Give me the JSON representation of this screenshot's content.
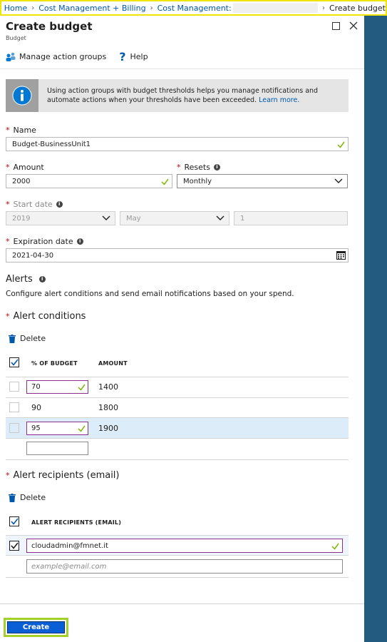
{
  "breadcrumb": {
    "home": "Home",
    "billing": "Cost Management + Billing",
    "cost_mgmt": "Cost Management:",
    "current": "Create budget"
  },
  "blade": {
    "title": "Create budget",
    "subtitle": "Budget"
  },
  "toolbar": {
    "manage_action_groups": "Manage action groups",
    "help": "Help"
  },
  "info": {
    "text": "Using action groups with budget thresholds helps you manage notifications and automate actions when your thresholds have been exceeded.",
    "link": "Learn more."
  },
  "form": {
    "name_label": "Name",
    "name_value": "Budget-BusinessUnit1",
    "amount_label": "Amount",
    "amount_value": "2000",
    "resets_label": "Resets",
    "resets_value": "Monthly",
    "start_date_label": "Start date",
    "start_year": "2019",
    "start_month": "May",
    "start_day": "1",
    "expiration_label": "Expiration date",
    "expiration_value": "2021-04-30"
  },
  "alerts": {
    "heading": "Alerts",
    "description": "Configure alert conditions and send email notifications based on your spend.",
    "conditions_heading": "Alert conditions",
    "delete_label": "Delete",
    "col_percent": "% OF BUDGET",
    "col_amount": "AMOUNT",
    "rows": [
      {
        "percent": "70",
        "amount": "1400"
      },
      {
        "percent": "90",
        "amount": "1800"
      },
      {
        "percent": "95",
        "amount": "1900"
      }
    ],
    "recipients_heading": "Alert recipients (email)",
    "recipients_delete_label": "Delete",
    "col_recipients": "ALERT RECIPIENTS (EMAIL)",
    "recipient_value": "cloudadmin@fmnet.it",
    "recipient_placeholder": "example@email.com"
  },
  "footer": {
    "create_label": "Create"
  },
  "colors": {
    "accent": "#0058ad",
    "primary_button": "#0a5fd6",
    "side_strip": "#225a80",
    "highlight_row": "#dcecf8",
    "valid_check": "#7ab800"
  }
}
